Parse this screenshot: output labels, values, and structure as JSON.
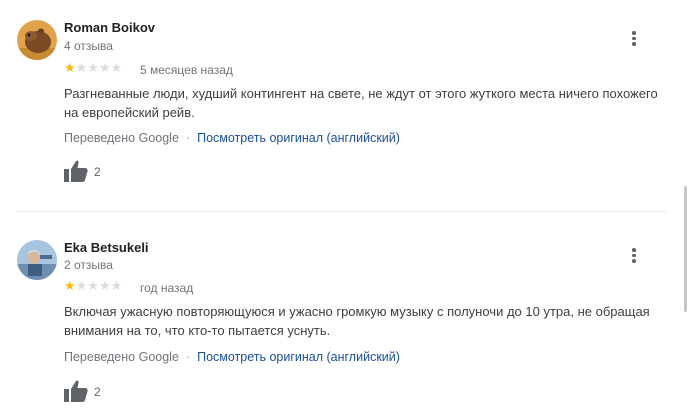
{
  "reviews": [
    {
      "author": "Roman Boikov",
      "review_count": "4 отзыва",
      "rating": 1,
      "rating_max": 5,
      "date": "5 месяцев назад",
      "text": "Разгневанные люди, худший контингент на свете, не ждут от этого жуткого места ничего похожего на европейский рейв.",
      "translated_label": "Переведено Google",
      "separator": "·",
      "original_link": "Посмотреть оригинал (английский)",
      "likes": "2"
    },
    {
      "author": "Eka Betsukeli",
      "review_count": "2 отзыва",
      "rating": 1,
      "rating_max": 5,
      "date": "год назад",
      "text": "Включая ужасную повторяющуюся и ужасно громкую музыку с полуночи до 10 утра, не обращая внимания на то, что кто-то пытается уснуть.",
      "translated_label": "Переведено Google",
      "separator": "·",
      "original_link": "Посмотреть оригинал (английский)",
      "likes": "2"
    }
  ],
  "colors": {
    "star_filled": "#fbbc04",
    "star_empty": "#dadce0",
    "link": "#1a4fa0"
  },
  "icons": {
    "menu": "more-vert-icon",
    "like": "thumb-up-icon"
  }
}
